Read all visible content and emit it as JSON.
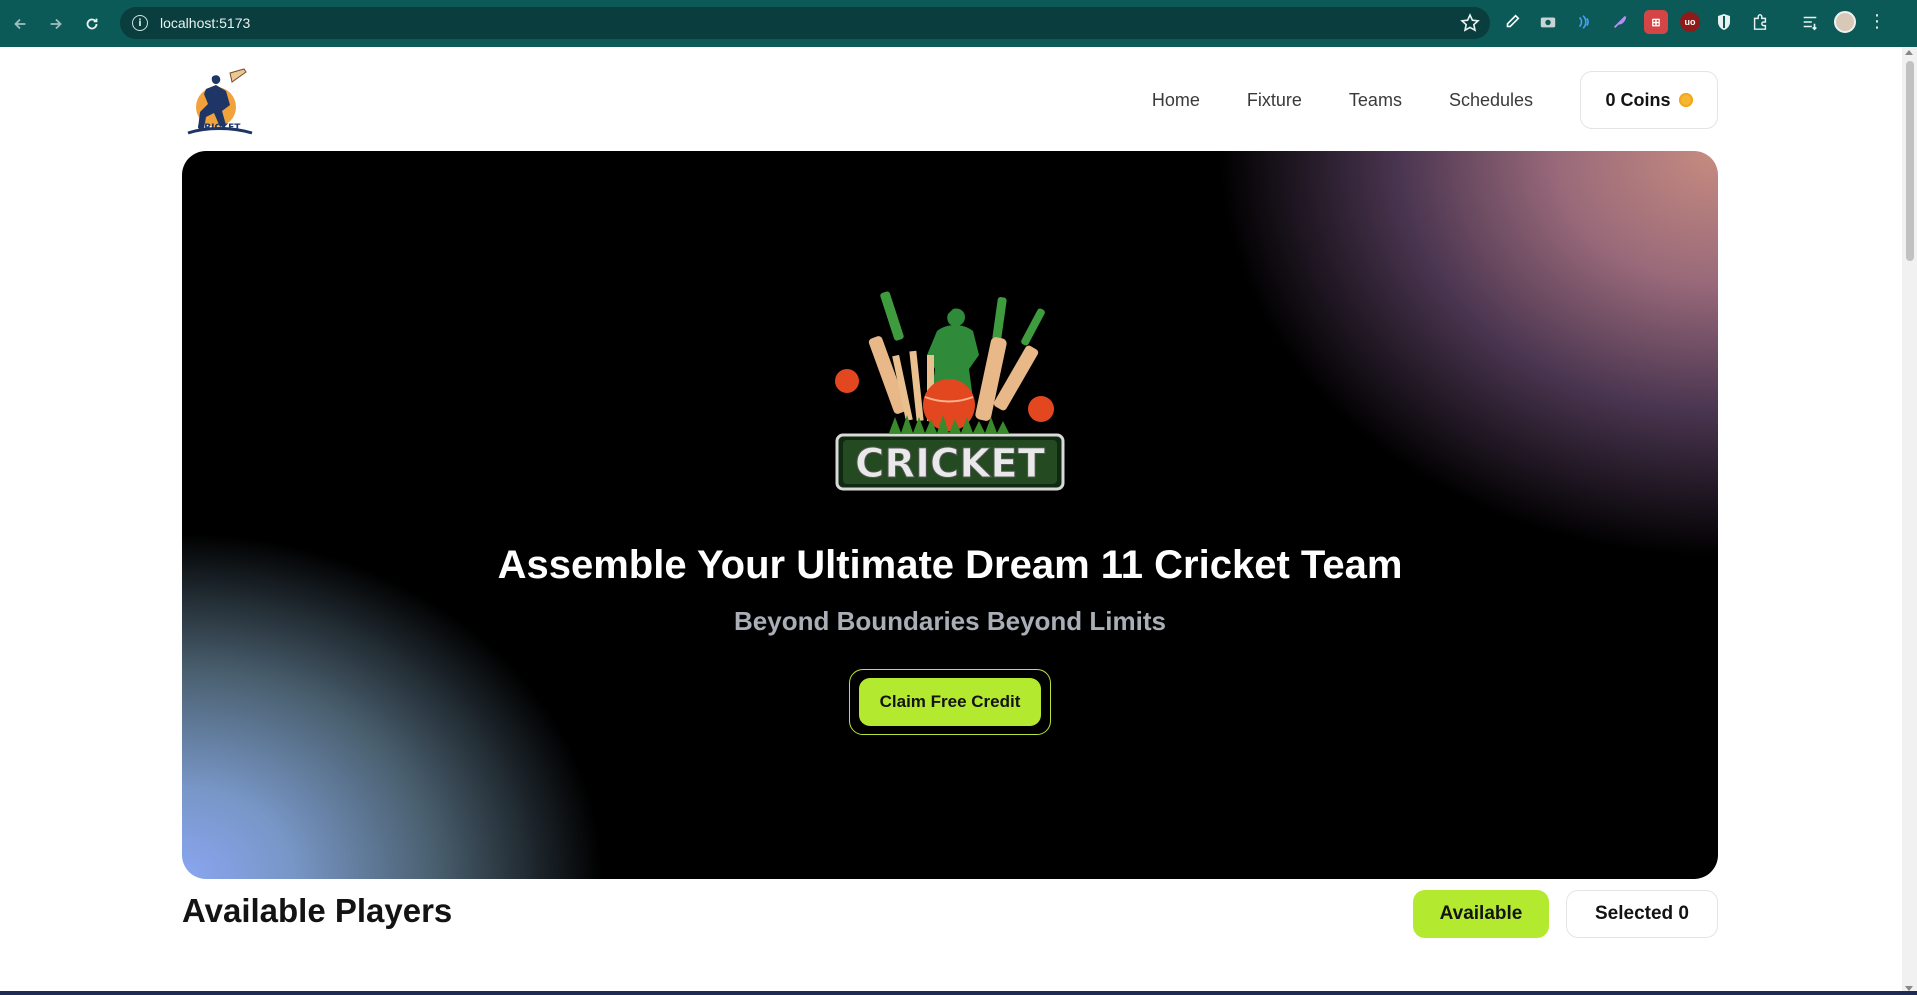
{
  "browser": {
    "url": "localhost:5173"
  },
  "header": {
    "logo_text": "CRICKET",
    "nav": [
      "Home",
      "Fixture",
      "Teams",
      "Schedules"
    ],
    "coins_label": "0 Coins"
  },
  "hero": {
    "badge_text": "CRICKET",
    "title": "Assemble Your Ultimate Dream 11 Cricket Team",
    "subtitle": "Beyond Boundaries Beyond Limits",
    "cta_label": "Claim Free Credit"
  },
  "players": {
    "title": "Available Players",
    "tab_available": "Available",
    "tab_selected": "Selected 0"
  },
  "colors": {
    "chrome": "#0c5a58",
    "accent": "#b3ea2f",
    "coin": "#f5b731"
  }
}
